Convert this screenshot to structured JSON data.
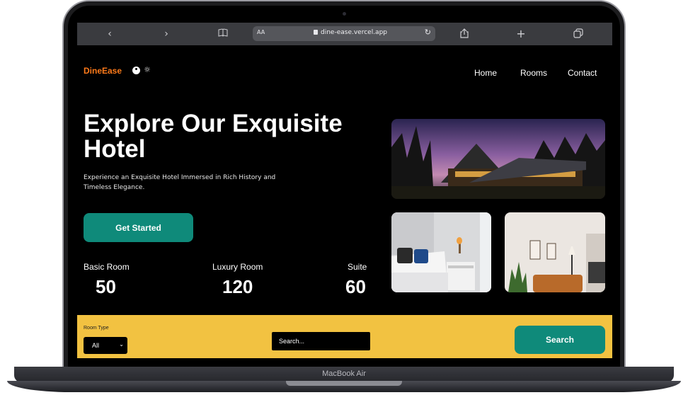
{
  "device": {
    "label": "MacBook Air"
  },
  "browser": {
    "text_size": "AA",
    "url": "dine-ease.vercel.app",
    "icons": [
      "back-icon",
      "forward-icon",
      "reader-icon",
      "reload-icon",
      "share-icon",
      "new-tab-icon",
      "tabs-icon"
    ]
  },
  "site": {
    "logo": "DineEase",
    "nav": [
      "Home",
      "Rooms",
      "Contact"
    ],
    "hero": {
      "title": "Explore Our Exquisite Hotel",
      "subtitle": "Experience an Exquisite Hotel Immersed in Rich History and Timeless Elegance.",
      "cta": "Get Started"
    },
    "stats": [
      {
        "label": "Basic Room",
        "value": "50"
      },
      {
        "label": "Luxury Room",
        "value": "120"
      },
      {
        "label": "Suite",
        "value": "60"
      }
    ],
    "search": {
      "room_type_label": "Room Type",
      "room_type_value": "All",
      "placeholder": "Search...",
      "button": "Search"
    }
  },
  "colors": {
    "brand": "#ff7a1a",
    "accent": "#0f8a7a",
    "search_bar": "#f2c241"
  }
}
